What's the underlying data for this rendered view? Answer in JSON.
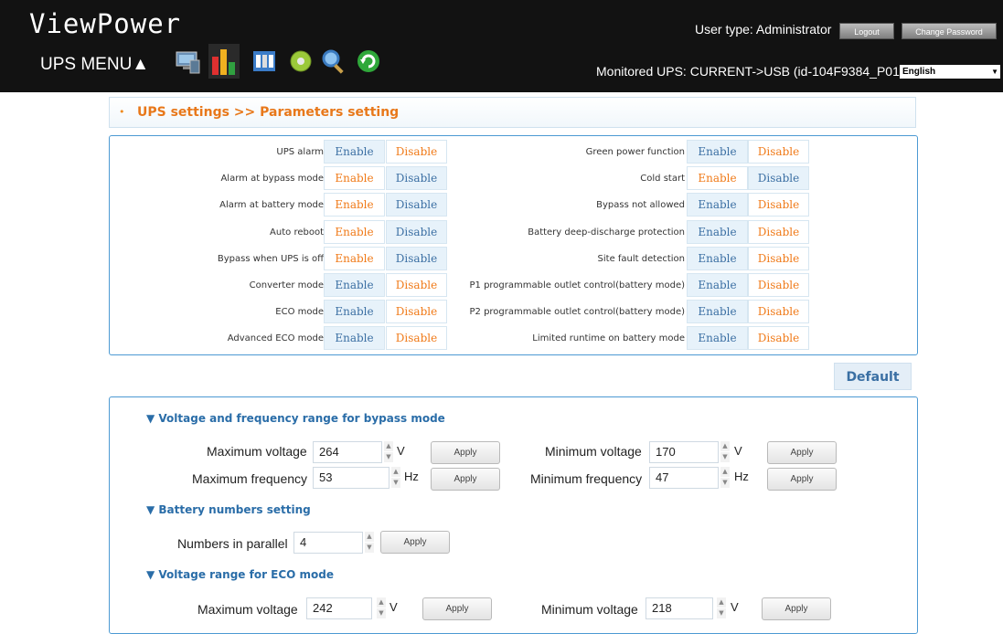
{
  "header": {
    "app_title": "ViewPower",
    "menu_label": "UPS MENU▲",
    "user_type": "User type: Administrator",
    "logout_label": "Logout",
    "change_password_label": "Change Password",
    "monitored": "Monitored UPS: CURRENT->USB (id-104F9384_P01)",
    "language": "English",
    "icons": [
      "monitor-icon",
      "chart-icon",
      "settings-tools-icon",
      "disc-icon",
      "search-icon",
      "refresh-icon"
    ]
  },
  "breadcrumb": "UPS settings >> Parameters setting",
  "toggle_labels": {
    "enable": "Enable",
    "disable": "Disable"
  },
  "left_params": [
    {
      "label": "UPS alarm",
      "selected": "Disable"
    },
    {
      "label": "Alarm at bypass mode",
      "selected": "Enable"
    },
    {
      "label": "Alarm at battery mode",
      "selected": "Enable"
    },
    {
      "label": "Auto reboot",
      "selected": "Enable"
    },
    {
      "label": "Bypass when UPS is off",
      "selected": "Enable"
    },
    {
      "label": "Converter mode",
      "selected": "Disable"
    },
    {
      "label": "ECO mode",
      "selected": "Disable"
    },
    {
      "label": "Advanced ECO mode",
      "selected": "Disable"
    }
  ],
  "right_params": [
    {
      "label": "Green power function",
      "selected": "Disable"
    },
    {
      "label": "Cold start",
      "selected": "Enable"
    },
    {
      "label": "Bypass not allowed",
      "selected": "Disable"
    },
    {
      "label": "Battery deep-discharge protection",
      "selected": "Disable"
    },
    {
      "label": "Site fault detection",
      "selected": "Disable"
    },
    {
      "label": "P1 programmable outlet control(battery mode)",
      "selected": "Disable"
    },
    {
      "label": "P2 programmable outlet control(battery mode)",
      "selected": "Disable"
    },
    {
      "label": "Limited runtime on battery mode",
      "selected": "Disable"
    }
  ],
  "default_label": "Default",
  "bypass_section": {
    "title": "▼ Voltage and frequency range for bypass mode",
    "max_voltage_label": "Maximum voltage",
    "max_voltage": "264",
    "max_voltage_unit": "V",
    "min_voltage_label": "Minimum voltage",
    "min_voltage": "170",
    "min_voltage_unit": "V",
    "max_freq_label": "Maximum frequency",
    "max_freq": "53",
    "max_freq_unit": "Hz",
    "min_freq_label": "Minimum frequency",
    "min_freq": "47",
    "min_freq_unit": "Hz"
  },
  "battery_section": {
    "title": "▼ Battery numbers setting",
    "parallel_label": "Numbers in parallel",
    "parallel_value": "4"
  },
  "eco_section": {
    "title": "▼ Voltage range for ECO mode",
    "max_voltage_label": "Maximum voltage",
    "max_voltage": "242",
    "max_voltage_unit": "V",
    "min_voltage_label": "Minimum voltage",
    "min_voltage": "218",
    "min_voltage_unit": "V"
  },
  "apply_label": "Apply"
}
